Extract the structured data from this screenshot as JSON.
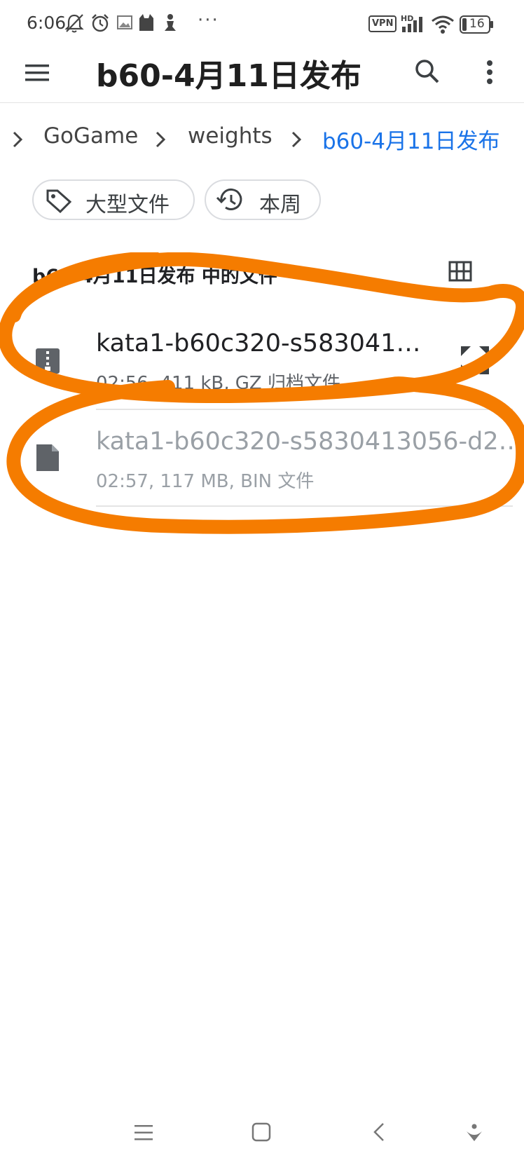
{
  "status_bar": {
    "time": "6:06",
    "more": "···",
    "battery": "16",
    "vpn": "VPN",
    "hd": "HD",
    "icons": [
      "mute-icon",
      "alarm-icon",
      "image-icon",
      "cat-icon",
      "person-icon",
      "vpn-icon",
      "signal-icon",
      "wifi-icon",
      "battery-icon"
    ]
  },
  "toolbar": {
    "title": "b60-4月11日发布",
    "icons": [
      "menu-icon",
      "search-icon",
      "more-vert-icon"
    ]
  },
  "breadcrumb": {
    "items": [
      {
        "label": "GoGame"
      },
      {
        "label": "weights"
      },
      {
        "label": "b60-4月11日发布"
      }
    ],
    "active_color": "#1a73e8"
  },
  "filters": {
    "chips": [
      {
        "label": "大型文件",
        "icon": "tag-icon"
      },
      {
        "label": "本周",
        "icon": "history-icon"
      }
    ]
  },
  "files": {
    "section_title": "b60-4月11日发布 中的文件",
    "grid_icon": "grid-view-icon",
    "items": [
      {
        "name": "kata1-b60c320-s583041…",
        "meta": "02:56, 411 kB, GZ 归档文件",
        "icon": "zip-file-icon",
        "action_icon": "expand-icon"
      },
      {
        "name": "kata1-b60c320-s5830413056-d2…",
        "meta": "02:57, 117 MB, BIN 文件",
        "icon": "file-icon"
      }
    ]
  },
  "annotation": {
    "color": "#f57c00"
  },
  "nav_bar": {
    "icons": [
      "recents-icon",
      "home-icon",
      "back-icon",
      "assistant-icon"
    ]
  }
}
